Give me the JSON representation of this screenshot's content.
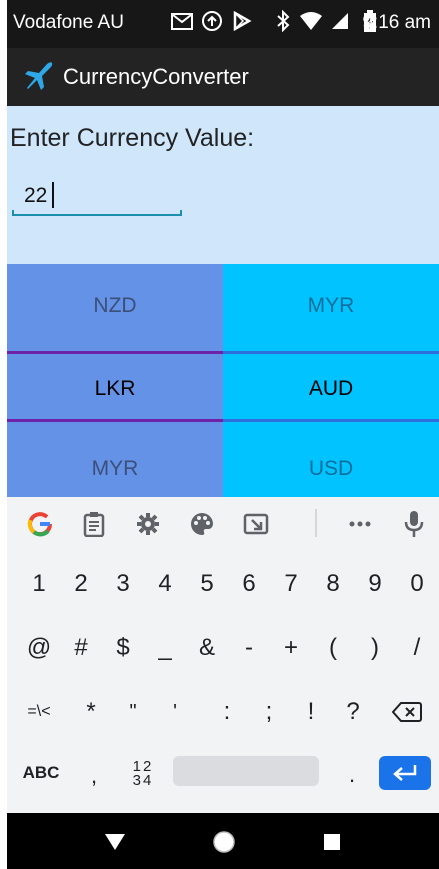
{
  "status_bar": {
    "carrier": "Vodafone AU",
    "time": "9:16 am",
    "icons": [
      "gmail-icon",
      "upload-icon",
      "play-store-icon",
      "bluetooth-icon",
      "wifi-icon",
      "signal-icon",
      "battery-icon"
    ]
  },
  "app_bar": {
    "title": "CurrencyConverter",
    "icon": "airplane-icon"
  },
  "form": {
    "label": "Enter Currency Value:",
    "value": "22"
  },
  "picker_left": {
    "items": [
      "NZD",
      "LKR",
      "MYR"
    ],
    "selected": "LKR"
  },
  "picker_right": {
    "items": [
      "MYR",
      "AUD",
      "USD"
    ],
    "selected": "AUD"
  },
  "keyboard": {
    "toolbar": [
      "google-icon",
      "clipboard-icon",
      "settings-icon",
      "palette-icon",
      "resize-icon",
      "more-icon",
      "mic-icon"
    ],
    "row_numbers": [
      "1",
      "2",
      "3",
      "4",
      "5",
      "6",
      "7",
      "8",
      "9",
      "0"
    ],
    "row_symbols": [
      "@",
      "#",
      "$",
      "_",
      "&",
      "-",
      "+",
      "(",
      ")",
      "/"
    ],
    "row_symbols2": [
      "=\\<",
      "*",
      "\"",
      "'",
      ":",
      ";",
      "!",
      "?"
    ],
    "bottom": {
      "abc": "ABC",
      "comma": ",",
      "numpad_top": "12",
      "numpad_bottom": "34",
      "period": "."
    }
  },
  "colors": {
    "background": "#cfe6fb",
    "picker_left": "#6492e6",
    "picker_right": "#00c3ff",
    "accent": "#1a73e8"
  }
}
